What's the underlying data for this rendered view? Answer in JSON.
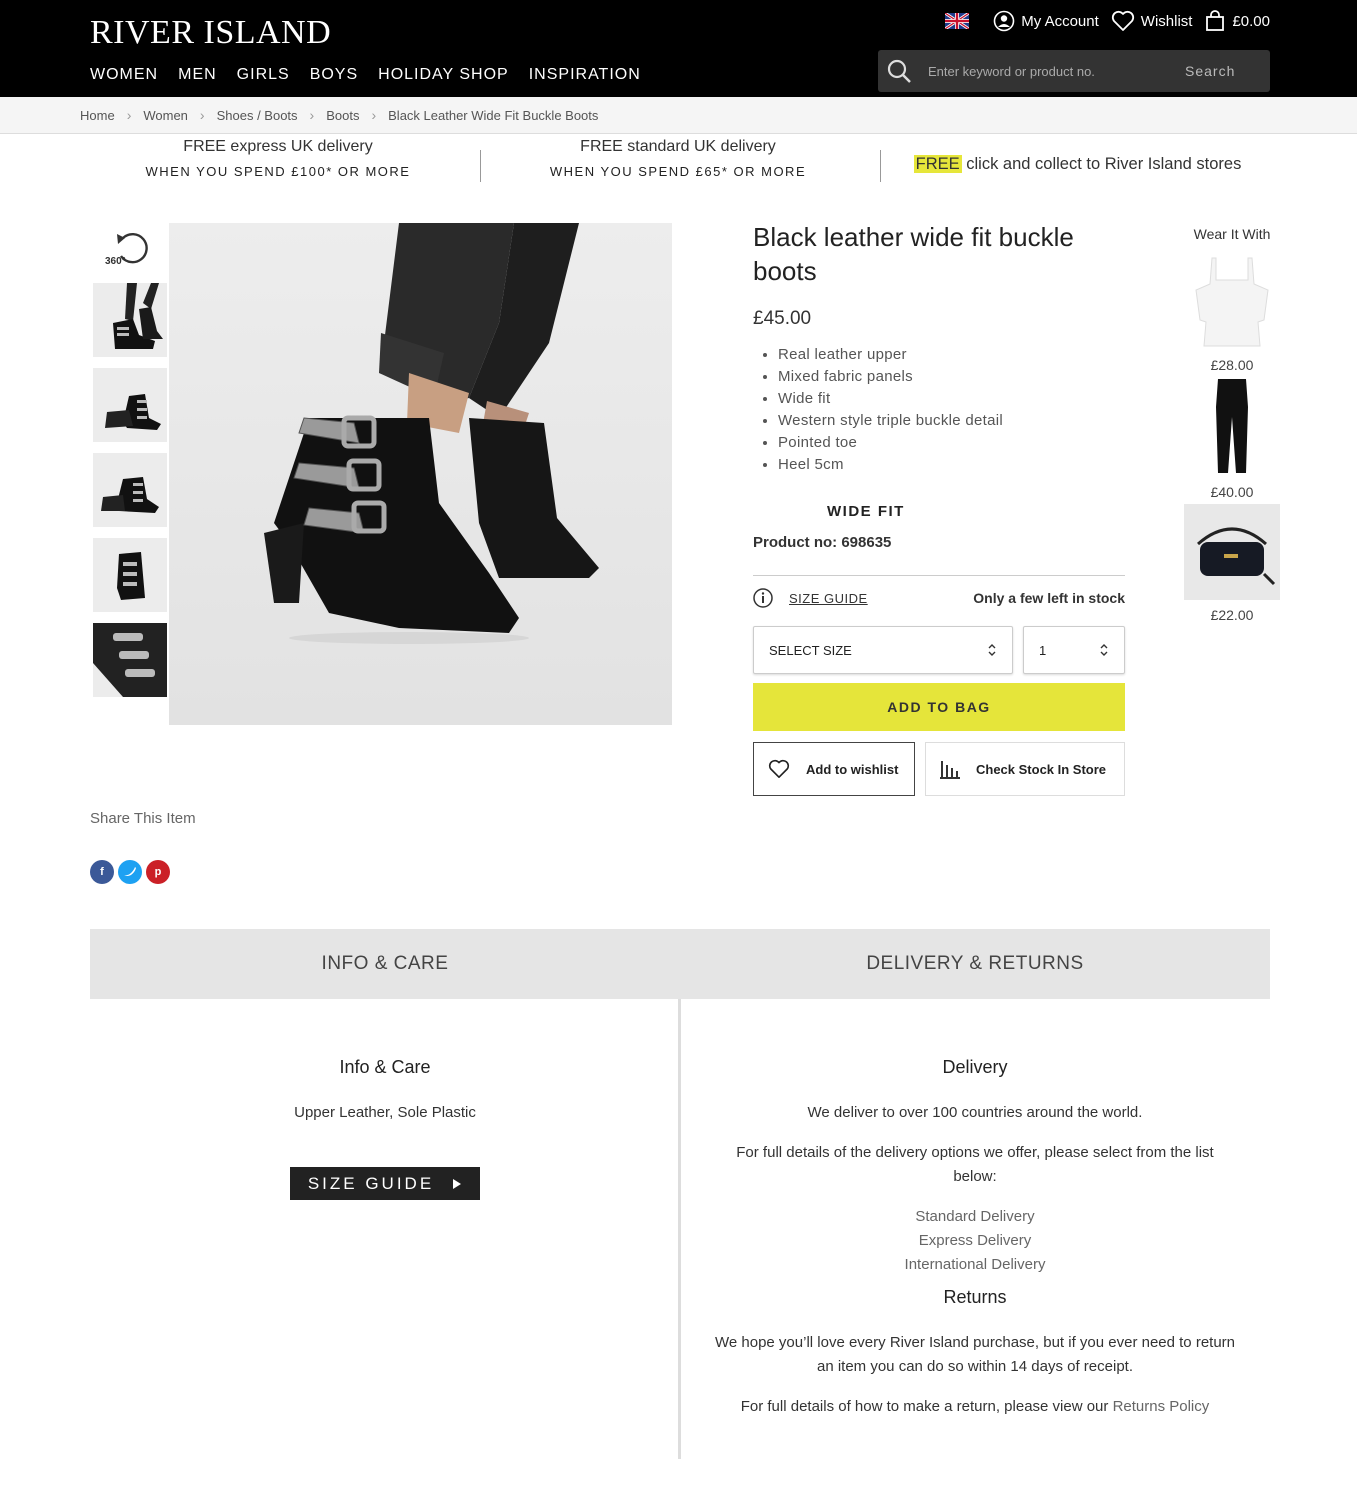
{
  "header": {
    "logo": "RIVER ISLAND",
    "nav": [
      "WOMEN",
      "MEN",
      "GIRLS",
      "BOYS",
      "HOLIDAY SHOP",
      "INSPIRATION"
    ],
    "account_label": "My Account",
    "wishlist_label": "Wishlist",
    "bag_total": "£0.00",
    "search_placeholder": "Enter keyword or product no.",
    "search_button": "Search"
  },
  "breadcrumb": [
    "Home",
    "Women",
    "Shoes / Boots",
    "Boots",
    "Black Leather Wide Fit Buckle Boots"
  ],
  "banner": [
    {
      "line1": "FREE express UK delivery",
      "line2": "WHEN YOU SPEND £100* OR MORE"
    },
    {
      "line1": "FREE standard UK delivery",
      "line2": "WHEN YOU SPEND £65* OR MORE"
    },
    {
      "highlight": "FREE",
      "rest": " click and collect to River Island stores"
    }
  ],
  "gallery": {
    "rotate_label": "360°"
  },
  "product": {
    "title": "Black leather wide fit buckle boots",
    "price": "£45.00",
    "features": [
      "Real leather upper",
      "Mixed fabric panels",
      "Wide fit",
      "Western style triple buckle detail",
      "Pointed toe",
      "Heel 5cm"
    ],
    "fit_label": "WIDE FIT",
    "product_no": "Product no: 698635",
    "size_guide": "SIZE GUIDE",
    "stock_status": "Only a few left in stock",
    "size_select": "SELECT SIZE",
    "quantity": "1",
    "add_to_bag": "ADD TO BAG",
    "add_to_wishlist": "Add to wishlist",
    "check_stock": "Check Stock In Store"
  },
  "wear_it_with": {
    "title": "Wear It With",
    "items": [
      {
        "price": "£28.00"
      },
      {
        "price": "£40.00"
      },
      {
        "price": "£22.00"
      }
    ]
  },
  "share": {
    "title": "Share This Item"
  },
  "tabs": [
    "INFO & CARE",
    "DELIVERY & RETURNS"
  ],
  "info_care": {
    "title": "Info & Care",
    "text": "Upper Leather, Sole Plastic",
    "size_guide_button": "SIZE GUIDE"
  },
  "delivery": {
    "title": "Delivery",
    "p1": "We deliver to over 100 countries around the world.",
    "p2": "For full details of the delivery options we offer, please select from the list below:",
    "links": [
      "Standard Delivery",
      "Express Delivery",
      "International Delivery"
    ],
    "returns_title": "Returns",
    "p3": "We hope you’ll love every River Island purchase, but if you ever need to return an item you can do so within 14 days of receipt.",
    "p4_prefix": "For full details of how to make a return, please view our ",
    "p4_link": "Returns Policy"
  },
  "colors": {
    "header_bg": "#000000",
    "accent_yellow": "#e5e53a",
    "tab_bg": "#e5e5e5"
  }
}
